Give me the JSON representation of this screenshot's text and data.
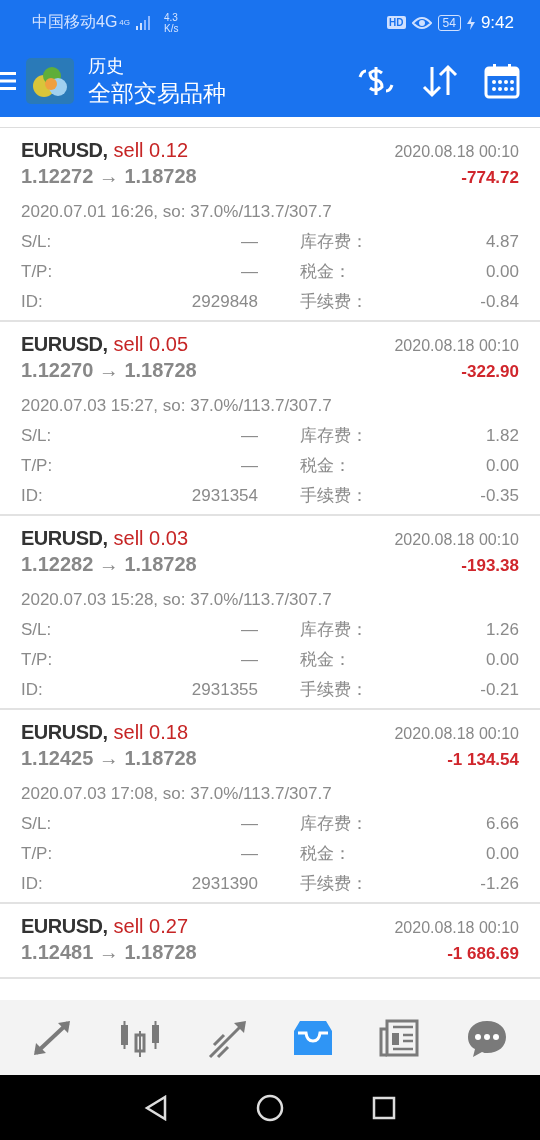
{
  "status_bar": {
    "carrier": "中国移动4G",
    "network_type": "4G",
    "speed_value": "4.3",
    "speed_unit": "K/s",
    "hd": "HD",
    "battery": "54",
    "time": "9:42"
  },
  "header": {
    "title": "历史",
    "subtitle": "全部交易品种"
  },
  "trades": [
    {
      "kind": "expanded",
      "symbol": "EURUSD,",
      "side": "sell 0.12",
      "prices": "1.12272 → 1.18728",
      "close_time": "2020.08.18 00:10",
      "profit": "-774.72",
      "summary": "2020.07.01 16:26, so: 37.0%/113.7/307.7",
      "details": [
        {
          "label": "S/L:",
          "value": "—",
          "fee_label": "库存费：",
          "fee_value": "4.87"
        },
        {
          "label": "T/P:",
          "value": "—",
          "fee_label": "税金：",
          "fee_value": "0.00"
        },
        {
          "label": "ID:",
          "value": "2929848",
          "fee_label": "手续费：",
          "fee_value": "-0.84"
        }
      ]
    },
    {
      "kind": "expanded",
      "symbol": "EURUSD,",
      "side": "sell 0.05",
      "prices": "1.12270 → 1.18728",
      "close_time": "2020.08.18 00:10",
      "profit": "-322.90",
      "summary": "2020.07.03 15:27, so: 37.0%/113.7/307.7",
      "details": [
        {
          "label": "S/L:",
          "value": "—",
          "fee_label": "库存费：",
          "fee_value": "1.82"
        },
        {
          "label": "T/P:",
          "value": "—",
          "fee_label": "税金：",
          "fee_value": "0.00"
        },
        {
          "label": "ID:",
          "value": "2931354",
          "fee_label": "手续费：",
          "fee_value": "-0.35"
        }
      ]
    },
    {
      "kind": "expanded",
      "symbol": "EURUSD,",
      "side": "sell 0.03",
      "prices": "1.12282 → 1.18728",
      "close_time": "2020.08.18 00:10",
      "profit": "-193.38",
      "summary": "2020.07.03 15:28, so: 37.0%/113.7/307.7",
      "details": [
        {
          "label": "S/L:",
          "value": "—",
          "fee_label": "库存费：",
          "fee_value": "1.26"
        },
        {
          "label": "T/P:",
          "value": "—",
          "fee_label": "税金：",
          "fee_value": "0.00"
        },
        {
          "label": "ID:",
          "value": "2931355",
          "fee_label": "手续费：",
          "fee_value": "-0.21"
        }
      ]
    },
    {
      "kind": "expanded",
      "symbol": "EURUSD,",
      "side": "sell 0.18",
      "prices": "1.12425 → 1.18728",
      "close_time": "2020.08.18 00:10",
      "profit": "-1 134.54",
      "summary": "2020.07.03 17:08, so: 37.0%/113.7/307.7",
      "details": [
        {
          "label": "S/L:",
          "value": "—",
          "fee_label": "库存费：",
          "fee_value": "6.66"
        },
        {
          "label": "T/P:",
          "value": "—",
          "fee_label": "税金：",
          "fee_value": "0.00"
        },
        {
          "label": "ID:",
          "value": "2931390",
          "fee_label": "手续费：",
          "fee_value": "-1.26"
        }
      ]
    },
    {
      "kind": "collapsed",
      "symbol": "EURUSD,",
      "side": "sell 0.27",
      "prices": "1.12481 → 1.18728",
      "close_time": "2020.08.18 00:10",
      "profit": "-1 686.69"
    }
  ],
  "nav": [
    {
      "kind": "quotes",
      "selected": false
    },
    {
      "kind": "chart",
      "selected": false
    },
    {
      "kind": "trade",
      "selected": false
    },
    {
      "kind": "history",
      "selected": true
    },
    {
      "kind": "news",
      "selected": false
    },
    {
      "kind": "chat",
      "selected": false
    }
  ]
}
